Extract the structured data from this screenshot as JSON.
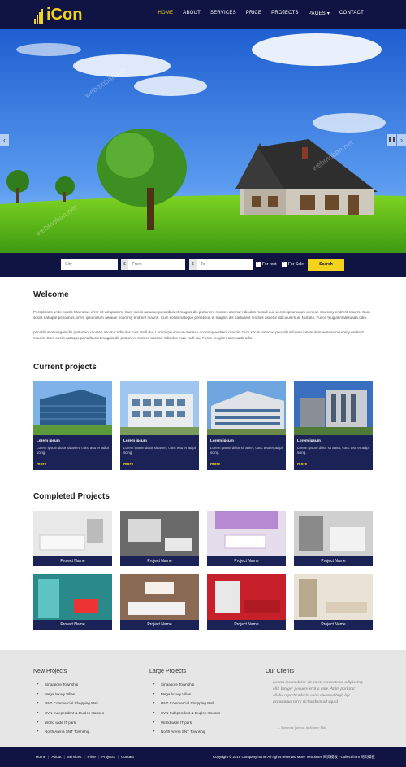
{
  "header": {
    "logo": "iCon",
    "nav": [
      "HOME",
      "ABOUT",
      "SERVICES",
      "PRICE",
      "PROJECTS",
      "PAGES ▾",
      "CONTACT"
    ]
  },
  "slider": {
    "prev_icon": "chevron-left-icon",
    "next_icon": "chevron-right-icon",
    "pause_icon": "pause-icon"
  },
  "search": {
    "city_placeholder": "City",
    "from_prefix": "$",
    "from_placeholder": "From",
    "to_prefix": "$",
    "to_placeholder": "To",
    "for_rent": "For rent",
    "for_sale": "For Sale",
    "button": "Search"
  },
  "welcome": {
    "title": "Welcome",
    "p1": "Persplclatls unde omnls lsta natus error sit voluptatem. Cum sociis natoque penatibus et magnis dis parturient montes ascetur ridiculus musull dui. Lorem ipsumulum aenean noummy endrerit mauris. Cum sociis natoque penatibus.lorem ipsumulum aenean noummy endrerit mauris. Cum sociis natoque penatibus et magnis dis parturient montes ascetur ridiculus mus. Null dui. Fusce feugiat malesuada odio.",
    "p2": "penatibus et magnis dis parturient montes ascetur ridiculus mus. Null dui. Lorem ipsumulum aenean noummy endrerit mauris. Cum sociis natoque penatibus.lorem ipsumulum aenean noummy endrerit mauris. Cum sociis natoque penatibus et magnis dis parturient montes ascetur ridiculus mus. Null dui. Fusce feugiat malesuada odio."
  },
  "current_projects": {
    "title": "Current projects",
    "items": [
      {
        "title": "Lorem ipsum",
        "desc": "Lorem ipsum dolor sit amet, conc tetu er adipi scing.",
        "more": "more"
      },
      {
        "title": "Lorem ipsum",
        "desc": "Lorem ipsum dolor sit amet, conc tetu er adipi scing.",
        "more": "more"
      },
      {
        "title": "Lorem ipsum",
        "desc": "Lorem ipsum dolor sit amet, conc tetu er adipi scing.",
        "more": "more"
      },
      {
        "title": "Lorem ipsum",
        "desc": "Lorem ipsum dolor sit amet, conc tetu er adipi scing.",
        "more": "more"
      }
    ]
  },
  "completed_projects": {
    "title": "Completed Projects",
    "items": [
      "Project Name",
      "Project Name",
      "Project Name",
      "Project Name",
      "Project Name",
      "Project Name",
      "Project Name",
      "Project Name"
    ]
  },
  "footer": {
    "new_projects": {
      "title": "New Projects",
      "items": [
        "Singapore Township",
        "Mega luxury Villas",
        "RNT Commercial Shopping Mall",
        "SVN Independent & Duplex Houses",
        "World wide IT park",
        "North Arena SNT Township"
      ]
    },
    "large_projects": {
      "title": "Large Projects",
      "items": [
        "Singapore Township",
        "Mega luxury Villas",
        "RNT Commercial Shopping Mall",
        "SVN Independent & Duplex Houses",
        "World wide IT park",
        "North Arena SNT Township"
      ]
    },
    "clients": {
      "title": "Our Clients",
      "quote": "Lorem ipsum dolor sit amet, consectetur adipiscing elit. Integer posuere erat a ante. Anim pariatur cliche reprehenderit, enim eiusmod high life accusamus terry richardson ad squid",
      "signature": "— Someone famous in Source Title"
    },
    "links": [
      "Home",
      "About",
      "Services",
      "Price",
      "Projects",
      "Contact"
    ],
    "copyright": "Copyright © 2015 Company name All rights reserved More Templates 网页模板 - Collect from 网页模板"
  },
  "watermark": "webmoban.net",
  "colors": {
    "navy": "#0f1442",
    "card": "#1b2255",
    "accent": "#f3d31b"
  }
}
